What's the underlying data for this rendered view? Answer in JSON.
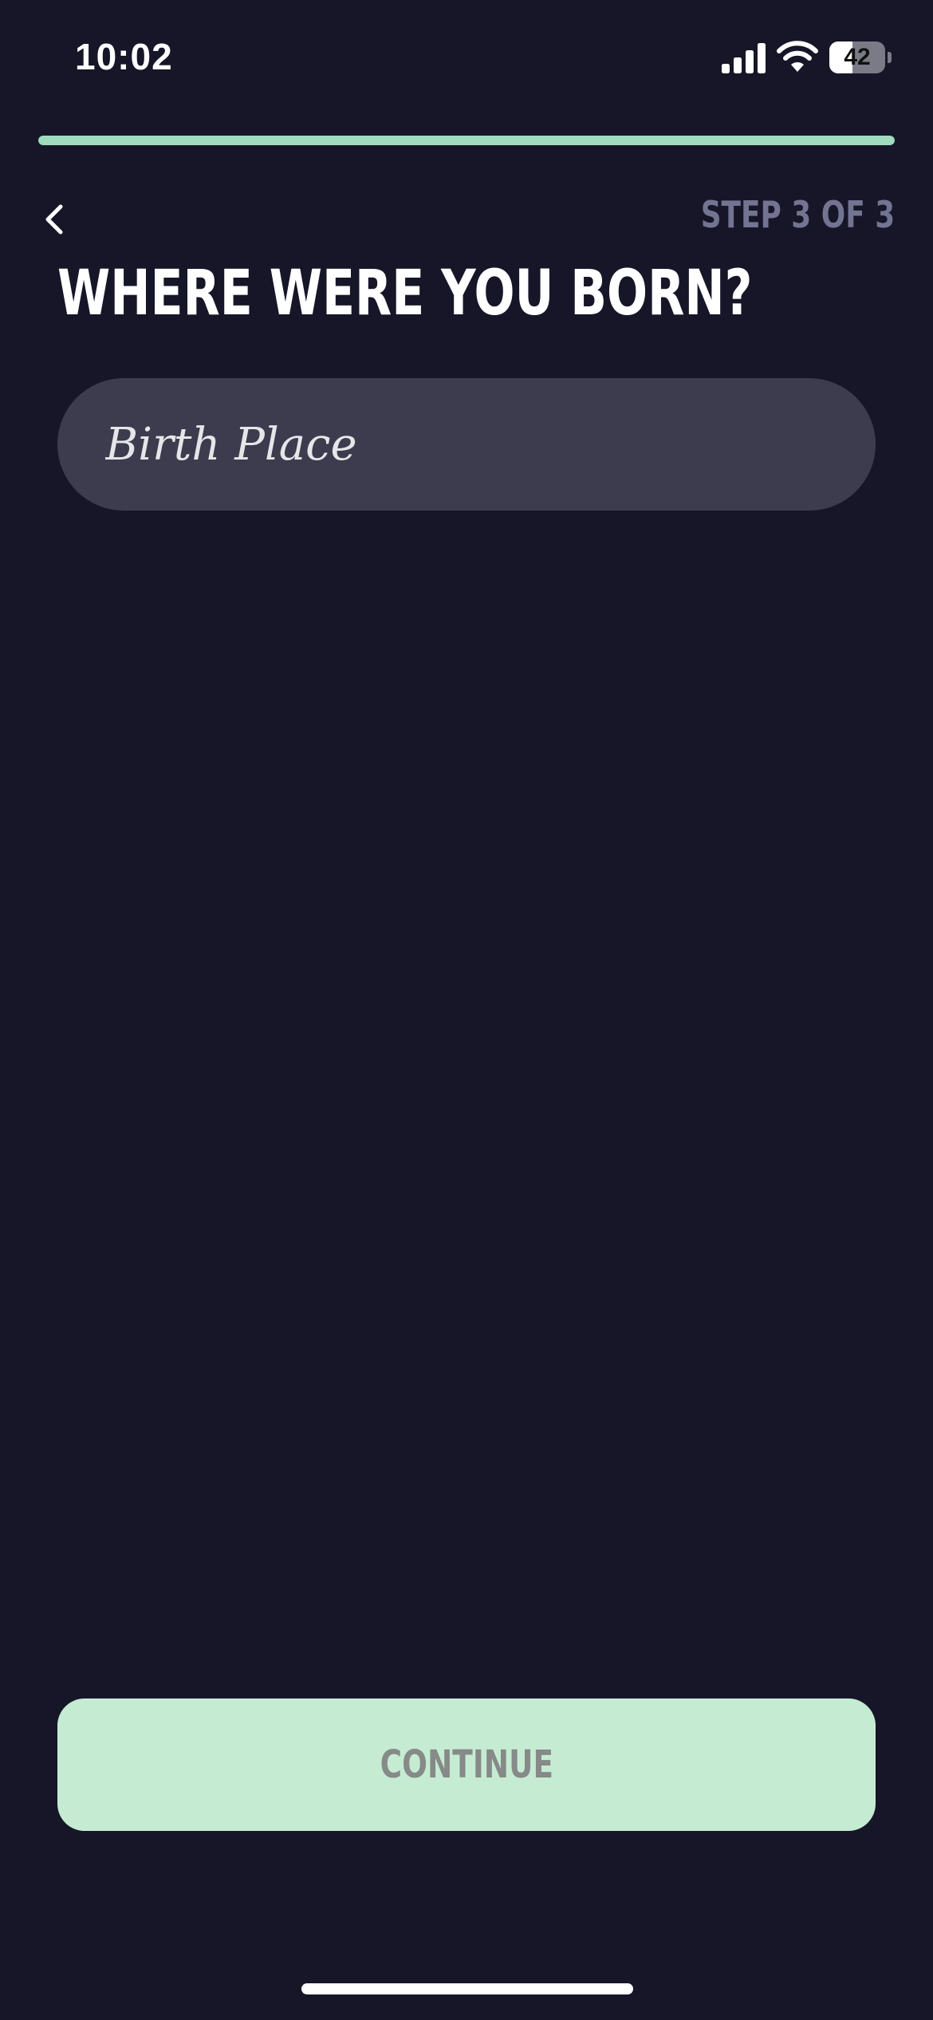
{
  "status_bar": {
    "time": "10:02",
    "battery_level": "42",
    "battery_fraction": 0.42,
    "icons": [
      "signal-icon",
      "wifi-icon",
      "battery-icon"
    ]
  },
  "progress": {
    "fraction": 1.0,
    "color": "#9fdcbf"
  },
  "header": {
    "back_icon": "chevron-left-icon",
    "step_label": "STEP 3 OF 3"
  },
  "main": {
    "title": "WHERE WERE YOU BORN?",
    "birth_place_input": {
      "value": "",
      "placeholder": "Birth Place"
    }
  },
  "footer": {
    "continue_label": "CONTINUE"
  },
  "colors": {
    "background": "#161628",
    "input_background": "#3d3c4e",
    "button_background": "#c5ecd2",
    "button_text": "#868a88",
    "step_text": "#737392"
  }
}
